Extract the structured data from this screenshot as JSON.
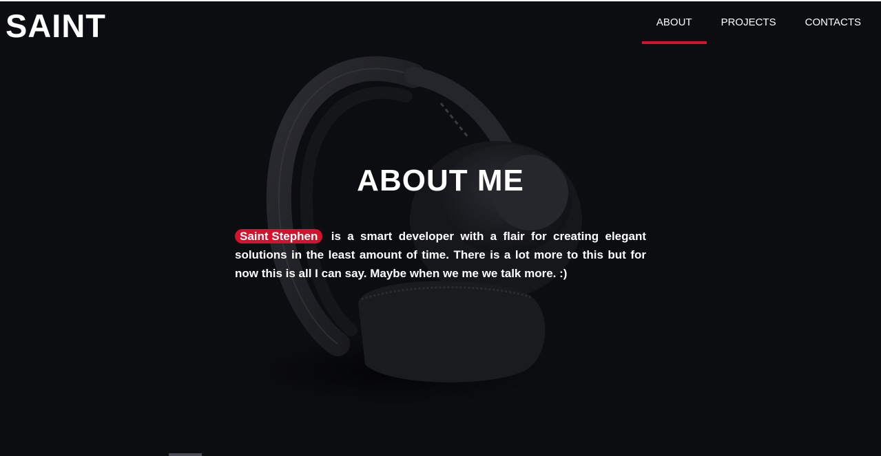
{
  "brand": {
    "logo": "SAINT"
  },
  "nav": {
    "items": [
      {
        "label": "ABOUT",
        "active": true
      },
      {
        "label": "PROJECTS",
        "active": false
      },
      {
        "label": "CONTACTS",
        "active": false
      }
    ]
  },
  "about": {
    "title": "ABOUT ME",
    "name": "Saint Stephen",
    "text": "is a smart developer with a flair for creating elegant solutions in the least amount of time. There is a lot more to this but for now this is all I can say. Maybe when we me we talk more. :)"
  },
  "colors": {
    "background": "#0c0d11",
    "accent": "#d4122e",
    "text": "#ffffff"
  },
  "hero_icon": "headphones-image"
}
